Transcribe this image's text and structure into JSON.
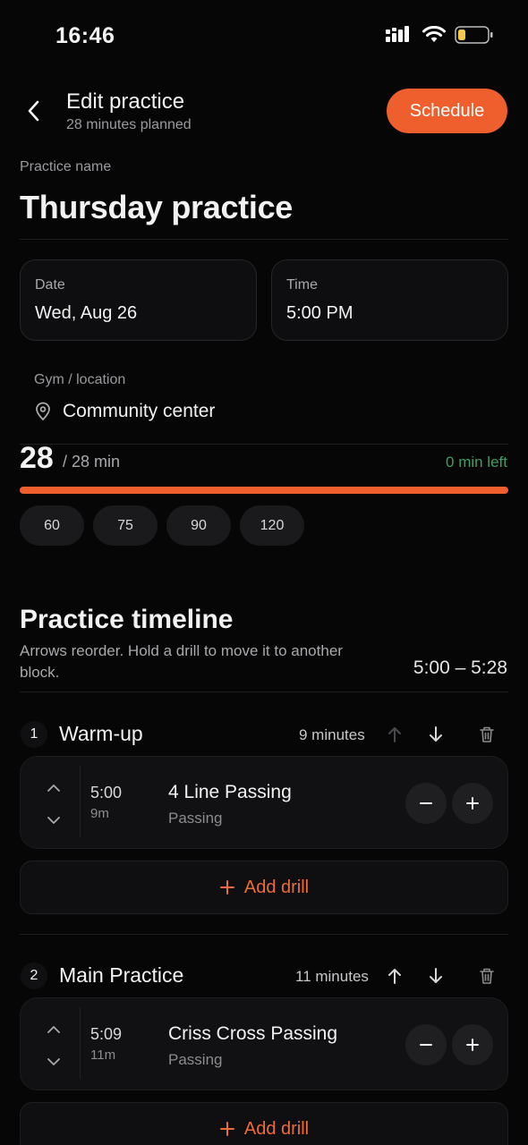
{
  "status_bar": {
    "time": "16:46"
  },
  "header": {
    "title": "Edit practice",
    "subtitle": "28 minutes planned",
    "schedule_label": "Schedule"
  },
  "practice_name": {
    "label": "Practice name",
    "value": "Thursday practice"
  },
  "date": {
    "label": "Date",
    "value": "Wed, Aug 26"
  },
  "time": {
    "label": "Time",
    "value": "5:00 PM"
  },
  "location": {
    "label": "Gym / location",
    "value": "Community center"
  },
  "duration": {
    "planned": "28",
    "of_total": "/ 28 min",
    "remaining": "0 min left",
    "progress_fraction": 1.0,
    "options": [
      "60",
      "75",
      "90",
      "120"
    ]
  },
  "timeline": {
    "title": "Practice timeline",
    "subtitle": "Arrows reorder. Hold a drill to move it to another block.",
    "range": "5:00 – 5:28",
    "add_drill_label": "Add drill",
    "blocks": [
      {
        "number": "1",
        "name": "Warm-up",
        "duration": "9 minutes",
        "drill": {
          "time": "5:00",
          "length": "9m",
          "name": "4 Line Passing",
          "category": "Passing"
        }
      },
      {
        "number": "2",
        "name": "Main Practice",
        "duration": "11 minutes",
        "drill": {
          "time": "5:09",
          "length": "11m",
          "name": "Criss Cross Passing",
          "category": "Passing"
        }
      }
    ]
  },
  "colors": {
    "accent": "#ee5f2d",
    "remaining": "#3d9e66",
    "background": "#060607"
  }
}
